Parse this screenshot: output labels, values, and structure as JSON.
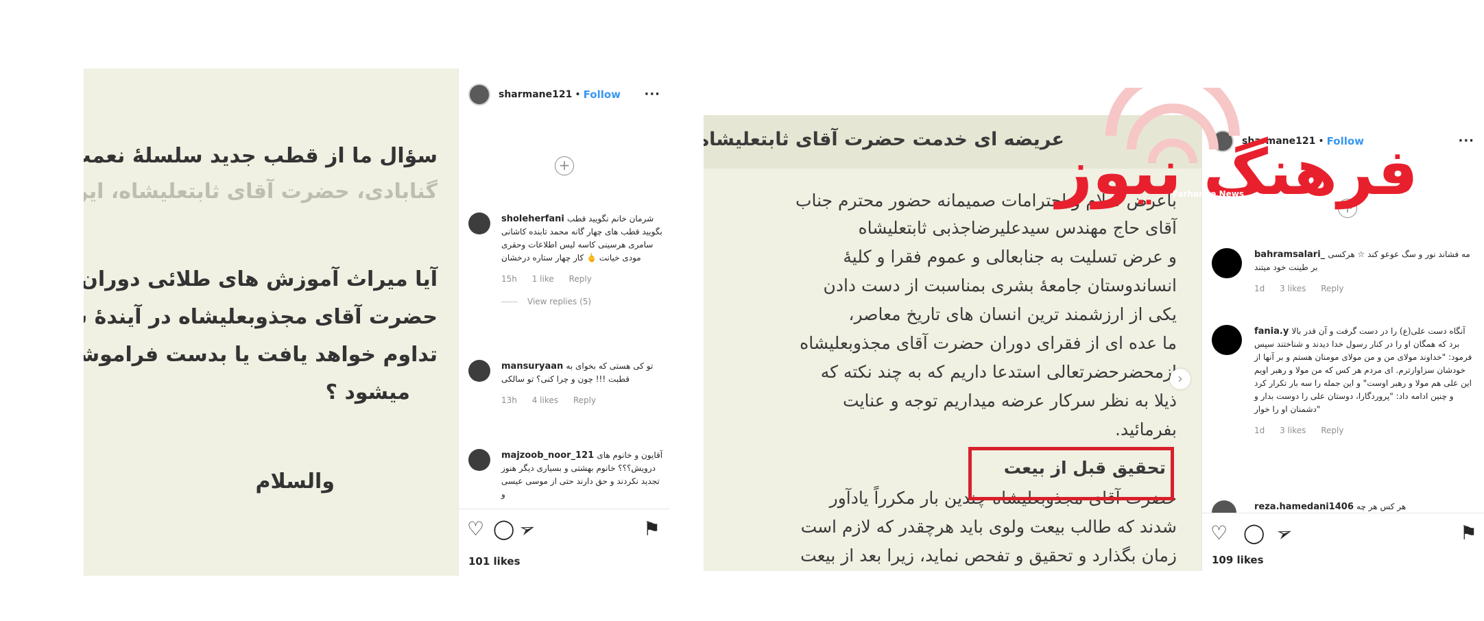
{
  "left_post": {
    "username": "sharmane121",
    "follow_label": "Follow",
    "more_label": "···",
    "image_lines": [
      "سؤال ما از قطب جدید سلسلهٔ نعمت الهی",
      "گنابادی، حضرت آقای ثابتعلیشاه، این است :",
      "آیا میراث آموزش های طلائی دوران قطبیت",
      "حضرت آقای مجذوبعلیشاه در آیندهٔ سلسله",
      "تداوم خواهد یافت یا بدست فراموشی سپرده",
      "میشود ؟",
      "والسلام"
    ],
    "comments": [
      {
        "user": "sholeherfani",
        "text": "شرمان خانم نگویید قطب بگویید قطب های چهار گانه محمد تابنده کاشانی سامری هرسینی کاسه لیس اطلاعات وحقری مودی خیانت 🖕 کار چهار ستاره درخشان",
        "time": "15h",
        "likes": "1 like",
        "reply": "Reply",
        "view_replies": "View replies (5)"
      },
      {
        "user": "mansuryaan",
        "text": "تو کی هستی که بخوای به قطبت !!! چون و چرا کنی؟ تو سالکی",
        "time": "13h",
        "likes": "4 likes",
        "reply": "Reply"
      },
      {
        "user": "majzoob_noor_121",
        "text": "آقایون و خانوم های درویش؟؟؟ خانوم بهشتی و بسیاری دیگر هنوز تجدید نکردند و حق دارند حتی از موسی عیسی و"
      }
    ],
    "likes": "101 likes"
  },
  "right_post": {
    "username": "sharmane121",
    "follow_label": "Follow",
    "more_label": "···",
    "image_title": "عریضه ای خدمت حضرت آقای ثابتعلیشاه",
    "image_lines": [
      "باعرض سلام و احترامات صمیمانه حضور محترم جناب",
      "آقای حاج مهندس سیدعلیرضاجذبی ثابتعلیشاه",
      "و عرض تسلیت به جنابعالی و عموم فقرا و کلیهٔ",
      "انساندوستان جامعهٔ بشری بمناسبت از دست دادن",
      "یکی از ارزشمند ترین انسان های تاریخ معاصر،",
      "ما عده ای از فقرای دوران حضرت آقای مجذوبعلیشاه",
      "ازمحضرحضرتعالی استدعا داریم که به چند نکته که",
      "ذیلا به نظر سرکار عرضه میداریم توجه و عنایت",
      "بفرمائید."
    ],
    "section_heading": "تحقیق قبل از بیعت",
    "section_lines": [
      "حضرت آقای مجذوبعلیشاه چندین بار مکرراً یادآور",
      "شدند که طالب بیعت ولوی  باید هرچقدر که لازم است",
      "زمان بگذارد و تحقیق و تفحص نماید، زیرا بعد از بیعت"
    ],
    "comments": [
      {
        "user": "bahramsalari_",
        "text": "مه فشاند نور و سگ عوعو کند ☆ هرکسی بر طینت خود میتند",
        "time": "1d",
        "likes": "3 likes",
        "reply": "Reply"
      },
      {
        "user": "fania.y",
        "text": "آنگاه دست علی(ع) را در دست گرفت و آن قدر بالا برد که همگان او را در کنار رسول خدا دیدند و شناختند سپس فرمود: \"خداوند مولای من و من مولای مومنان هستم و بر آنها از خودشان سزاوارترم. ای مردم هر کس که من مولا و رهبر اویم این علی هم مولا و رهبر اوست\" و این جمله را سه بار تکرار کرد و چنین ادامه داد: \"پروردگارا، دوستان علی را دوست بدار و دشمنان او را خوار\"",
        "time": "1d",
        "likes": "3 likes",
        "reply": "Reply"
      },
      {
        "user": "reza.hamedani1406",
        "text": "هر کس هر چه"
      }
    ],
    "likes": "109 likes"
  },
  "watermark": {
    "logo_text": "فرهنگ نیوز",
    "logo_sub": "Farhange News",
    "color": "#e8202d"
  }
}
